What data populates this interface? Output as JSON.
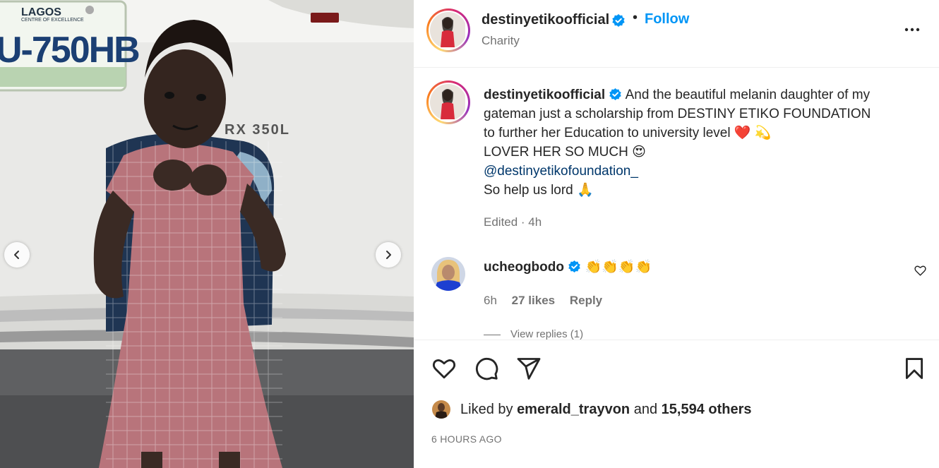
{
  "post": {
    "username": "destinyetikoofficial",
    "verified": true,
    "separator": "•",
    "follow_label": "Follow",
    "subtitle": "Charity"
  },
  "caption": {
    "username": "destinyetikoofficial",
    "line1": "And the beautiful melanin daughter of my",
    "line2": "gateman just a scholarship from DESTINY ETIKO FOUNDATION",
    "line3": "to further her Education to university level ❤️ 💫",
    "line4": "LOVER HER SO MUCH 😍",
    "mention": "@destinyetikofoundation_",
    "line6": "So help us lord 🙏",
    "meta": "Edited · 4h"
  },
  "comment": {
    "username": "ucheogbodo",
    "verified": true,
    "text": "👏👏👏👏",
    "time": "6h",
    "likes": "27 likes",
    "reply_label": "Reply",
    "view_replies": "View replies (1)"
  },
  "likes": {
    "prefix": "Liked by",
    "user": "emerald_trayvon",
    "conj": "and",
    "others": "15,594 others"
  },
  "timestamp": "6 HOURS AGO",
  "photo": {
    "plate_state": "LAGOS",
    "plate_motto": "CENTRE OF EXCELLENCE",
    "plate_number": "U-750HB",
    "car_badge": "RX 350L"
  },
  "icons": {
    "header_more": "more-horizontal-icon",
    "like": "heart-icon",
    "comment": "comment-icon",
    "share": "share-icon",
    "save": "bookmark-icon",
    "prev": "chevron-left-icon",
    "next": "chevron-right-icon"
  },
  "colors": {
    "follow": "#0095f6",
    "verified": "#0095f6",
    "mention": "#00376b",
    "muted": "#737373"
  }
}
